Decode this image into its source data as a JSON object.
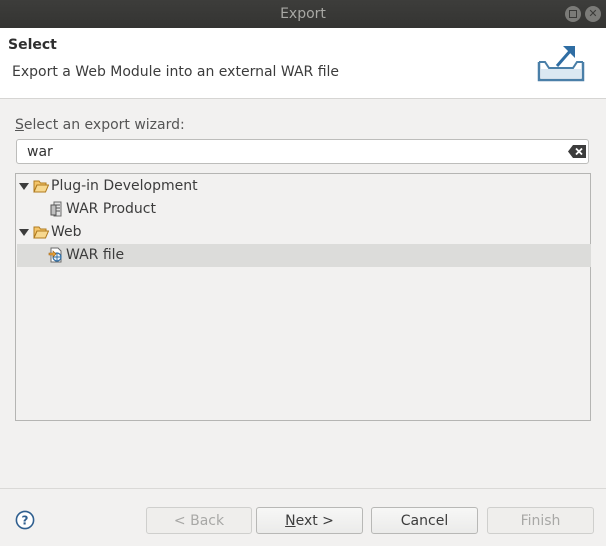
{
  "window": {
    "title": "Export"
  },
  "banner": {
    "title": "Select",
    "description": "Export a Web Module into an external WAR file",
    "icon": "export-icon"
  },
  "wizard": {
    "label_mnemonic": "S",
    "label_rest": "elect an export wizard:",
    "filter_value": "war"
  },
  "tree": {
    "items": [
      {
        "label": "Plug-in Development",
        "level": 0,
        "expanded": true,
        "icon": "folder-open-icon"
      },
      {
        "label": "WAR Product",
        "level": 1,
        "icon": "war-product-icon"
      },
      {
        "label": "Web",
        "level": 0,
        "expanded": true,
        "icon": "folder-open-icon"
      },
      {
        "label": "WAR file",
        "level": 1,
        "icon": "war-file-icon",
        "selected": true
      }
    ]
  },
  "buttons": {
    "back": "< Back",
    "next_mnemonic": "N",
    "next_rest": "ext >",
    "cancel": "Cancel",
    "finish": "Finish"
  },
  "colors": {
    "titlebar": "#3d3d3b",
    "selection": "#dcdcda",
    "folder": "#e8a33a"
  }
}
